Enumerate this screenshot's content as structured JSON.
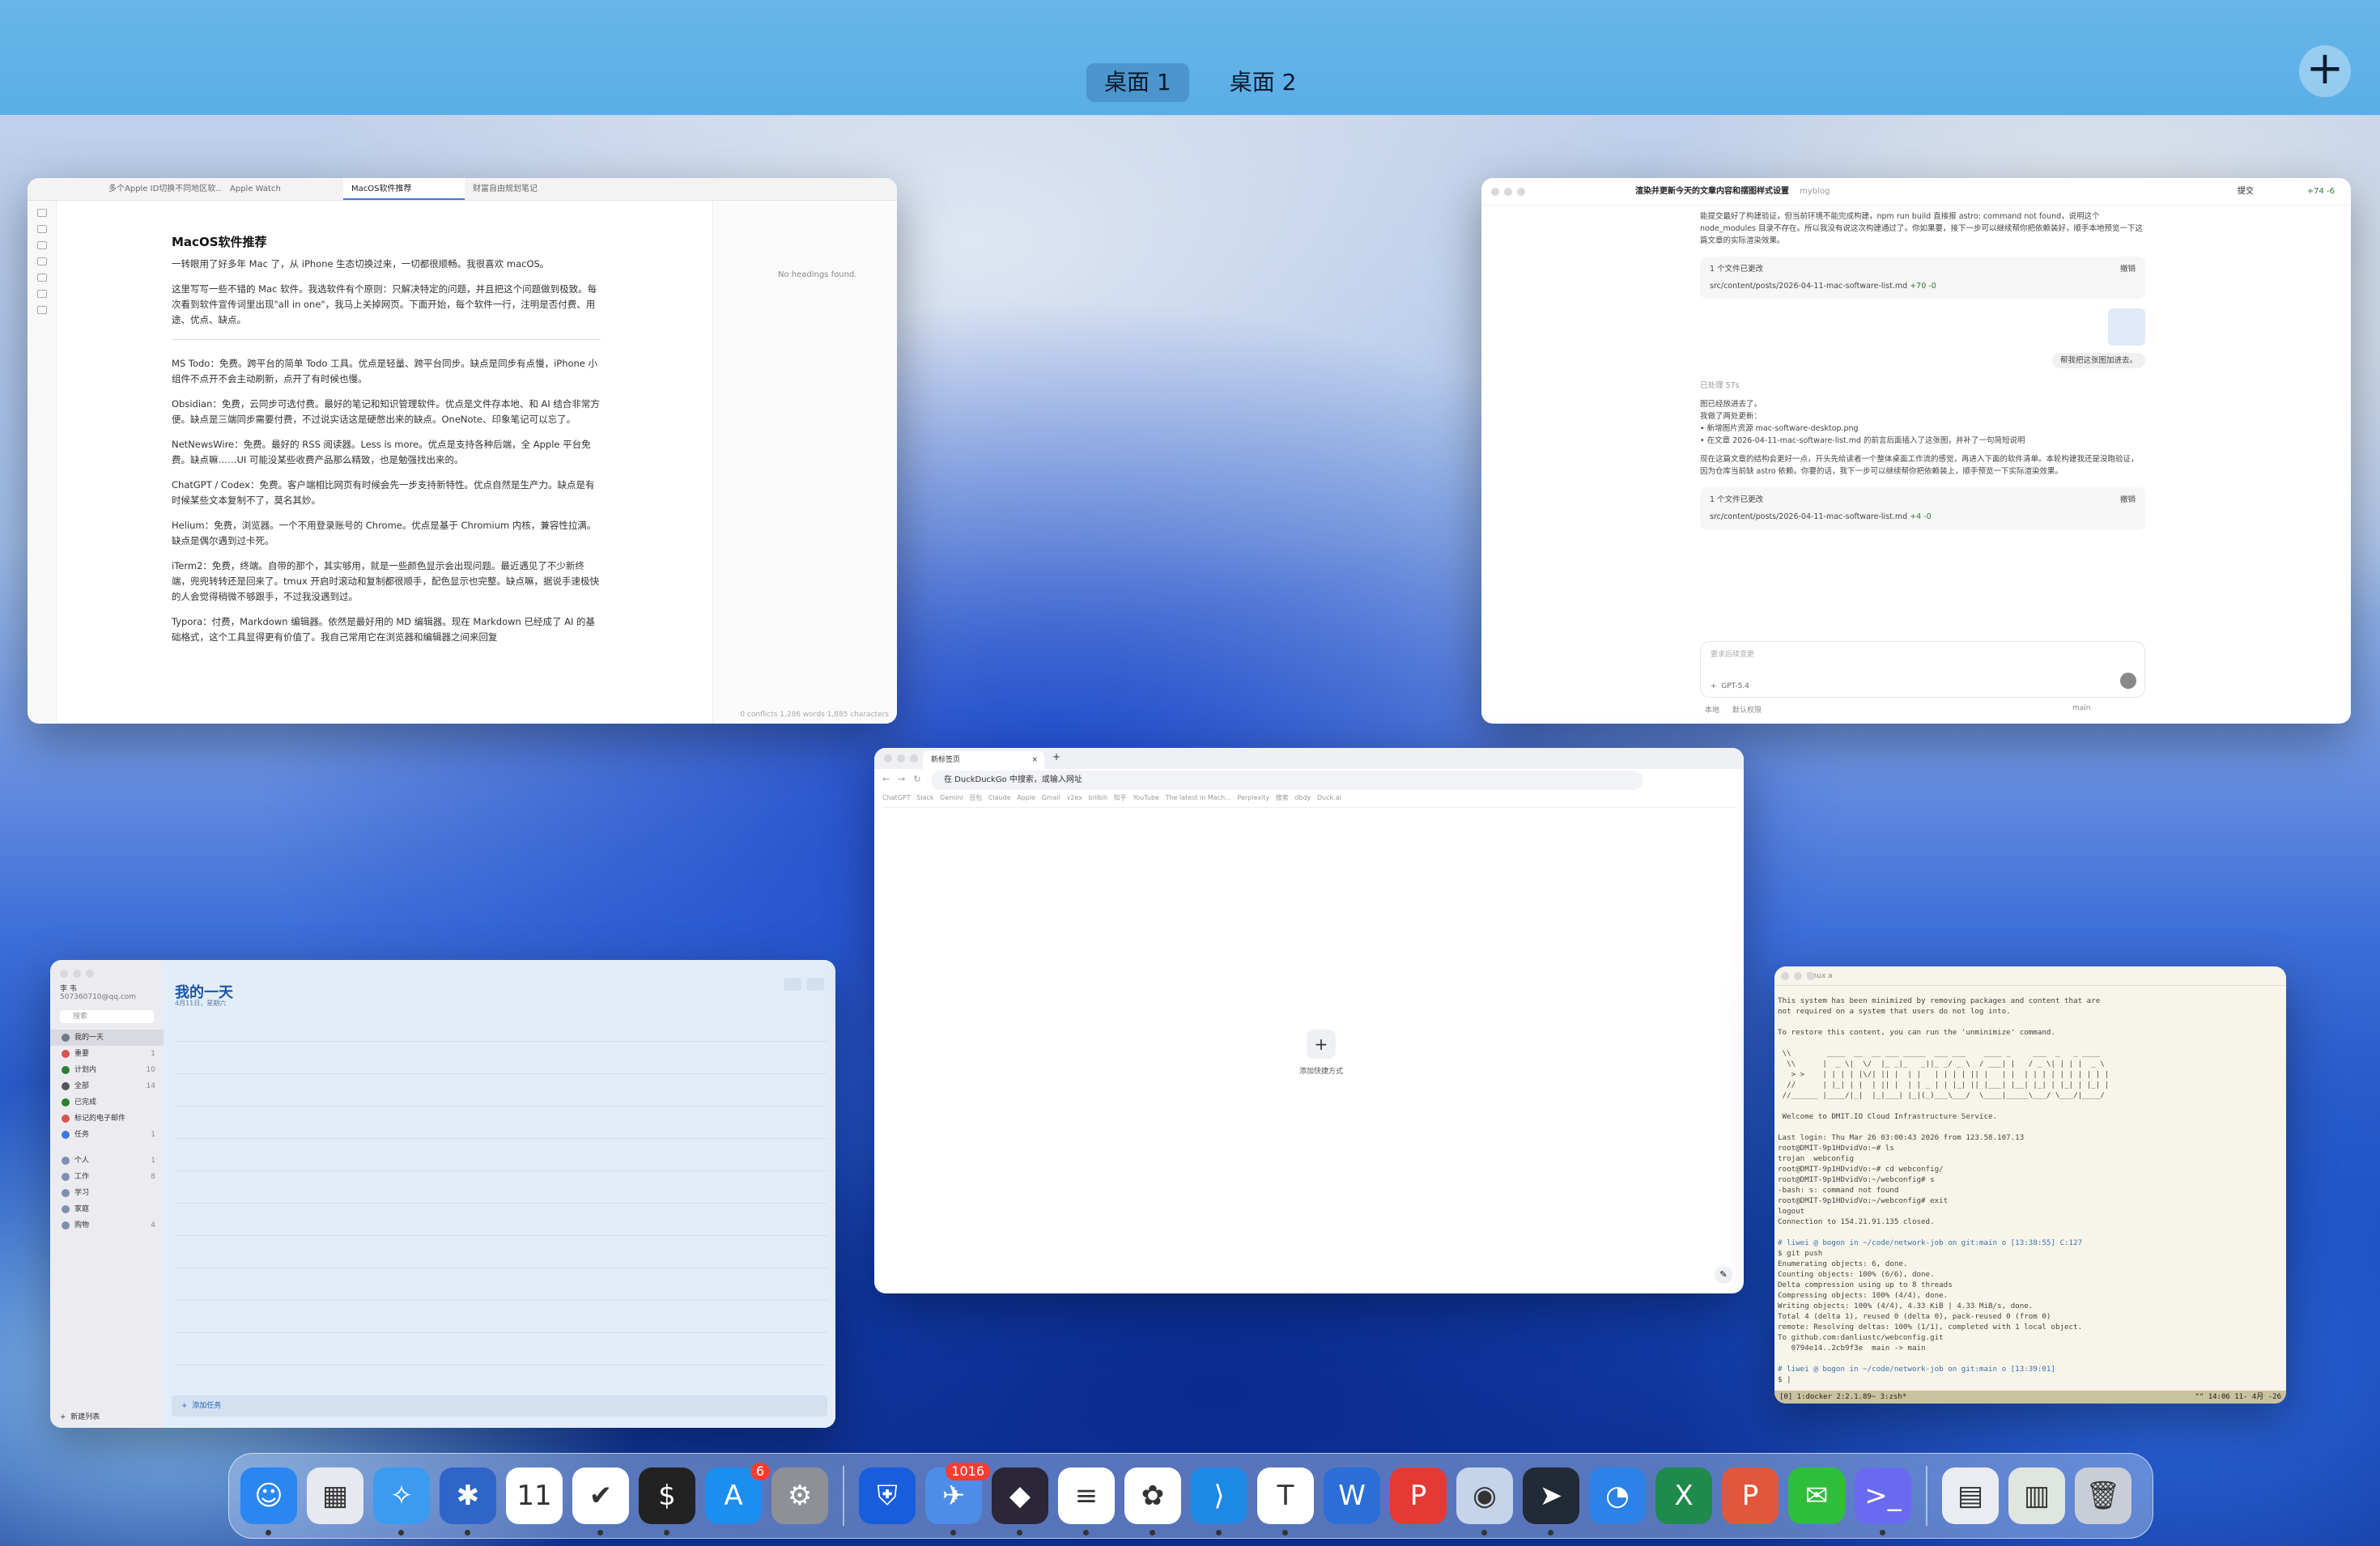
{
  "mission_control": {
    "spaces": [
      "桌面 1",
      "桌面 2"
    ],
    "active_space": 0
  },
  "colors": {
    "topbar": "#5aaee6",
    "accent": "#3b78e7",
    "reminders_title": "#1a56a5"
  },
  "typora": {
    "tabs": [
      "多个Apple ID切换不同地区软...",
      "Apple Watch",
      "MacOS软件推荐",
      "财富自由规划笔记"
    ],
    "active_tab": 2,
    "outline_empty": "No headings found.",
    "status": "0 conflicts   1,286 words   1,885 characters",
    "title": "MacOS软件推荐",
    "paragraphs": [
      "一转眼用了好多年 Mac 了，从 iPhone 生态切换过来，一切都很顺畅。我很喜欢 macOS。",
      "这里写写一些不错的 Mac 软件。我选软件有个原则：只解决特定的问题，并且把这个问题做到极致。每次看到软件宣传词里出现\"all in one\"，我马上关掉网页。下面开始，每个软件一行，注明是否付费、用途、优点、缺点。",
      "MS Todo：免费。跨平台的简单 Todo 工具。优点是轻量、跨平台同步。缺点是同步有点慢，iPhone 小组件不点开不会主动刷新，点开了有时候也慢。",
      "Obsidian：免费，云同步可选付费。最好的笔记和知识管理软件。优点是文件存本地、和 AI 结合非常方便。缺点是三端同步需要付费，不过说实话这是硬憋出来的缺点。OneNote、印象笔记可以忘了。",
      "NetNewsWire：免费。最好的 RSS 阅读器。Less is more。优点是支持各种后端，全 Apple 平台免费。缺点嘛……UI 可能没某些收费产品那么精致，也是勉强找出来的。",
      "ChatGPT / Codex：免费。客户端相比网页有时候会先一步支持新特性。优点自然是生产力。缺点是有时候某些文本复制不了，莫名其妙。",
      "Helium：免费，浏览器。一个不用登录账号的 Chrome。优点是基于 Chromium 内核，兼容性拉满。缺点是偶尔遇到过卡死。",
      "iTerm2：免费，终端。自带的那个，其实够用，就是一些颜色显示会出现问题。最近遇见了不少新终端，兜兜转转还是回来了。tmux 开启时滚动和复制都很顺手，配色显示也完整。缺点嘛，据说手速极快的人会觉得稍微不够跟手，不过我没遇到过。",
      "Typora：付费，Markdown 编辑器。依然是最好用的 MD 编辑器。现在 Markdown 已经成了 AI 的基础格式，这个工具显得更有价值了。我自己常用它在浏览器和编辑器之间来回复"
    ]
  },
  "coder": {
    "header_title": "渲染并更新今天的文章内容和摆图样式设置",
    "header_project": "myblog",
    "header_right": "提交",
    "header_diff": "+74 -6",
    "intro": "能提交最好了构建验证，但当前环境不能完成构建，npm run build 直接报 astro: command not found，说明这个 node_modules 目录不存在。所以我没有说这次构建通过了。你如果要，接下一步可以继续帮你把依赖装好，顺手本地预览一下这篇文章的实际渲染效果。",
    "card1": {
      "label": "1 个文件已更改",
      "action": "撤销",
      "file": "src/content/posts/2026-04-11-mac-software-list.md",
      "diff": "+70 -0"
    },
    "user_msg": "帮我把这张图加进去。",
    "meta": "已处理 57s",
    "reply_head": "图已经放进去了。",
    "reply_sub": "我做了两处更新：",
    "bullets": [
      "新增图片资源 mac-software-desktop.png",
      "在文章 2026-04-11-mac-software-list.md 的前言后面插入了这张图，并补了一句简短说明"
    ],
    "reply_tail": "现在这篇文章的结构会更好一点，开头先给读者一个整体桌面工作流的感觉，再进入下面的软件清单。本轮构建我还是没跑验证，因为仓库当前缺 astro 依赖。你要的话，我下一步可以继续帮你把依赖装上，顺手预览一下实际渲染效果。",
    "card2": {
      "label": "1 个文件已更改",
      "action": "撤销",
      "file": "src/content/posts/2026-04-11-mac-software-list.md",
      "diff": "+4 -0"
    },
    "input_placeholder": "要求后续变更",
    "model": "GPT-5.4",
    "footer_left": "本地",
    "footer_mode": "默认权限",
    "footer_branch": "main"
  },
  "reminders": {
    "user_name": "李 韦",
    "user_email": "507360710@qq.com",
    "search_placeholder": "搜索",
    "title": "我的一天",
    "date": "4月11日，星期六",
    "smart_lists": [
      {
        "label": "我的一天",
        "count": "",
        "color": "#6c7a89"
      },
      {
        "label": "重要",
        "count": "1",
        "color": "#d9534f"
      },
      {
        "label": "计划内",
        "count": "10",
        "color": "#2e7d32"
      },
      {
        "label": "全部",
        "count": "14",
        "color": "#555"
      },
      {
        "label": "已完成",
        "count": "",
        "color": "#2e7d32"
      },
      {
        "label": "标记的电子邮件",
        "count": "",
        "color": "#d9534f"
      },
      {
        "label": "任务",
        "count": "1",
        "color": "#3b78e7"
      }
    ],
    "lists": [
      {
        "label": "个人",
        "count": "1"
      },
      {
        "label": "工作",
        "count": "8"
      },
      {
        "label": "学习",
        "count": ""
      },
      {
        "label": "家庭",
        "count": ""
      },
      {
        "label": "购物",
        "count": "4"
      }
    ],
    "new_list": "新建列表",
    "add_task": "添加任务"
  },
  "browser": {
    "tab_title": "新标签页",
    "url_placeholder": "在 DuckDuckGo 中搜索，或输入网址",
    "bookmarks": [
      "ChatGPT",
      "Slack",
      "Gemini",
      "豆包",
      "Claude",
      "Apple",
      "Gmail",
      "v2ex",
      "bilibili",
      "知乎",
      "YouTube",
      "The latest in Mach...",
      "Perplexity",
      "搜索",
      "dbdy",
      "Duck.ai"
    ],
    "shortcut_label": "添加快捷方式"
  },
  "terminal": {
    "title": "tmux a",
    "lines": [
      "This system has been minimized by removing packages and content that are",
      "not required on a system that users do not log into.",
      "",
      "To restore this content, you can run the 'unminimize' command.",
      "",
      " \\\\        ____  __  __ ___ _____  ___ ___    ____ _     ___  _   _ ____",
      "  \\\\      |  _ \\|  \\/  |_ _|_   _||_ _/ _ \\  / ___| |   / _ \\| | | |  _ \\",
      "   > >    | | | | |\\/| || |  | |   | | | | || |   | |  | | | | | | | | | |",
      "  //      | |_| | |  | || |  | | _ | | |_| || |___| |__| |_| | |_| | |_| |",
      " //______ |____/|_|  |_|___| |_|(_)___\\___/  \\____|_____\\___/ \\___/|____/",
      "",
      " Welcome to DMIT.IO Cloud Infrastructure Service.",
      "",
      "Last login: Thu Mar 26 03:00:43 2026 from 123.58.107.13",
      "root@DMIT-9p1HDvidVo:~# ls",
      "trojan  webconfig",
      "root@DMIT-9p1HDvidVo:~# cd webconfig/",
      "root@DMIT-9p1HDvidVo:~/webconfig# s",
      "-bash: s: command not found",
      "root@DMIT-9p1HDvidVo:~/webconfig# exit",
      "logout",
      "Connection to 154.21.91.135 closed.",
      "",
      "# liwei @ bogon in ~/code/network-job on git:main o [13:38:55] C:127",
      "$ git push",
      "Enumerating objects: 6, done.",
      "Counting objects: 100% (6/6), done.",
      "Delta compression using up to 8 threads",
      "Compressing objects: 100% (4/4), done.",
      "Writing objects: 100% (4/4), 4.33 KiB | 4.33 MiB/s, done.",
      "Total 4 (delta 1), reused 0 (delta 0), pack-reused 0 (from 0)",
      "remote: Resolving deltas: 100% (1/1), completed with 1 local object.",
      "To github.com:danliustc/webconfig.git",
      "   0794e14..2cb9f3e  main -> main",
      "",
      "# liwei @ bogon in ~/code/network-job on git:main o [13:39:01]",
      "$ |"
    ],
    "status_left": "[0] 1:docker  2:2.1.89~ 3:zsh*",
    "status_right": "\"\" 14:06 11- 4月 -26"
  },
  "dock": {
    "apps": [
      {
        "name": "finder-icon",
        "glyph": "☺",
        "bg": "#2a86f0",
        "running": true
      },
      {
        "name": "launchpad-icon",
        "glyph": "▦",
        "bg": "#e6e9ef",
        "running": false
      },
      {
        "name": "safari-icon",
        "glyph": "✧",
        "bg": "#3a9bf0",
        "running": true
      },
      {
        "name": "perplexity-icon",
        "glyph": "✱",
        "bg": "#2f64c9",
        "running": true
      },
      {
        "name": "calendar-icon",
        "glyph": "11",
        "bg": "#ffffff",
        "running": false
      },
      {
        "name": "todo-icon",
        "glyph": "✔",
        "bg": "#ffffff",
        "running": true
      },
      {
        "name": "terminal-icon",
        "glyph": "$",
        "bg": "#222222",
        "running": true
      },
      {
        "name": "app-store-icon",
        "glyph": "A",
        "bg": "#1c8ef0",
        "running": false,
        "badge": "6"
      },
      {
        "name": "system-settings-icon",
        "glyph": "⚙",
        "bg": "#8e9097",
        "running": false
      },
      {
        "name": "bitwarden-icon",
        "glyph": "⛨",
        "bg": "#175ddc",
        "running": false
      },
      {
        "name": "netnewswire-icon",
        "glyph": "✈",
        "bg": "#4d8de8",
        "running": true,
        "badge": "1016"
      },
      {
        "name": "obsidian-icon",
        "glyph": "◆",
        "bg": "#2b2738",
        "running": true
      },
      {
        "name": "notes-icon",
        "glyph": "≡",
        "bg": "#ffffff",
        "running": true
      },
      {
        "name": "chatgpt-icon",
        "glyph": "✿",
        "bg": "#ffffff",
        "running": true
      },
      {
        "name": "vscode-icon",
        "glyph": "⟩",
        "bg": "#1e88e5",
        "running": true
      },
      {
        "name": "typora-icon",
        "glyph": "T",
        "bg": "#ffffff",
        "running": true
      },
      {
        "name": "word-icon",
        "glyph": "W",
        "bg": "#2b6fd6",
        "running": false
      },
      {
        "name": "pdf-icon",
        "glyph": "P",
        "bg": "#e53935",
        "running": false
      },
      {
        "name": "helium-icon",
        "glyph": "◉",
        "bg": "#c5d4ea",
        "running": true
      },
      {
        "name": "telegram-icon",
        "glyph": "➤",
        "bg": "#222a36",
        "running": true
      },
      {
        "name": "activity-icon",
        "glyph": "◔",
        "bg": "#2c82e6",
        "running": false
      },
      {
        "name": "excel-icon",
        "glyph": "X",
        "bg": "#1e8a4c",
        "running": false
      },
      {
        "name": "powerpoint-icon",
        "glyph": "P",
        "bg": "#e2573c",
        "running": false
      },
      {
        "name": "wechat-icon",
        "glyph": "✉",
        "bg": "#2fbe3a",
        "running": false
      },
      {
        "name": "remote-icon",
        "glyph": ">_",
        "bg": "#6a6af0",
        "running": true
      }
    ],
    "right": [
      {
        "name": "documents-stack-icon",
        "glyph": "▤",
        "bg": "#e9edf2"
      },
      {
        "name": "downloads-stack-icon",
        "glyph": "▥",
        "bg": "#dfe6e0"
      },
      {
        "name": "trash-icon",
        "glyph": "🗑",
        "bg": "#c9ced6"
      }
    ]
  }
}
